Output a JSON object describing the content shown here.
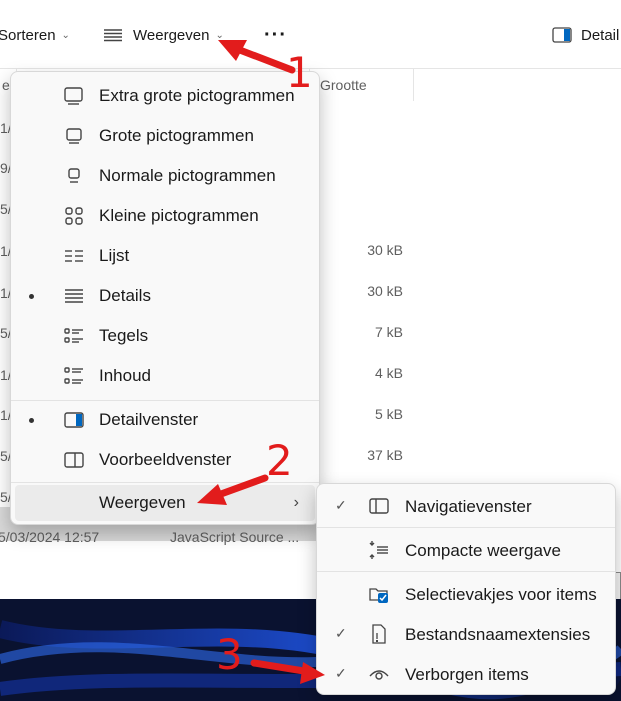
{
  "toolbar": {
    "sort_label": "Sorteren",
    "view_label": "Weergeven",
    "more_label": "···",
    "details_label": "Detail"
  },
  "columns": {
    "name_frag": "e",
    "size": "Grootte"
  },
  "file_rows": {
    "date_fragments": [
      "1/",
      "9/",
      "5/",
      "1/",
      "1/",
      "5/",
      "1/",
      "1/",
      "5/",
      "5/"
    ],
    "sizes": [
      "30 kB",
      "30 kB",
      "7 kB",
      "4 kB",
      "5 kB",
      "37 kB"
    ],
    "last_row": {
      "date": "5/03/2024 12:57",
      "type": "JavaScript Source ..."
    }
  },
  "view_menu": {
    "items": [
      {
        "label": "Extra grote pictogrammen",
        "icon": "monitor-large-icon",
        "selected": false
      },
      {
        "label": "Grote pictogrammen",
        "icon": "monitor-icon",
        "selected": false
      },
      {
        "label": "Normale pictogrammen",
        "icon": "monitor-small-icon",
        "selected": false
      },
      {
        "label": "Kleine pictogrammen",
        "icon": "grid-icon",
        "selected": false
      },
      {
        "label": "Lijst",
        "icon": "list-icon",
        "selected": false
      },
      {
        "label": "Details",
        "icon": "details-icon",
        "selected": true
      },
      {
        "label": "Tegels",
        "icon": "tiles-icon",
        "selected": false
      },
      {
        "label": "Inhoud",
        "icon": "content-icon",
        "selected": false
      },
      {
        "label": "Detailvenster",
        "icon": "details-pane-icon",
        "selected": true
      },
      {
        "label": "Voorbeeldvenster",
        "icon": "preview-pane-icon",
        "selected": false
      },
      {
        "label": "Weergeven",
        "icon": "",
        "selected": false
      }
    ]
  },
  "show_submenu": {
    "items": [
      {
        "label": "Navigatievenster",
        "icon": "navigation-pane-icon",
        "checked": true
      },
      {
        "label": "Compacte weergave",
        "icon": "compact-view-icon",
        "checked": false
      },
      {
        "label": "Selectievakjes voor items",
        "icon": "checkbox-folder-icon",
        "checked": false
      },
      {
        "label": "Bestandsnaamextensies",
        "icon": "file-extension-icon",
        "checked": true
      },
      {
        "label": "Verborgen items",
        "icon": "eye-icon",
        "checked": true
      }
    ]
  },
  "annotations": {
    "step1": "1",
    "step2": "2",
    "step3": "3"
  },
  "colors": {
    "arrow": "#e21c1c",
    "accent": "#0067c0",
    "selection": "#d9d9d9"
  }
}
